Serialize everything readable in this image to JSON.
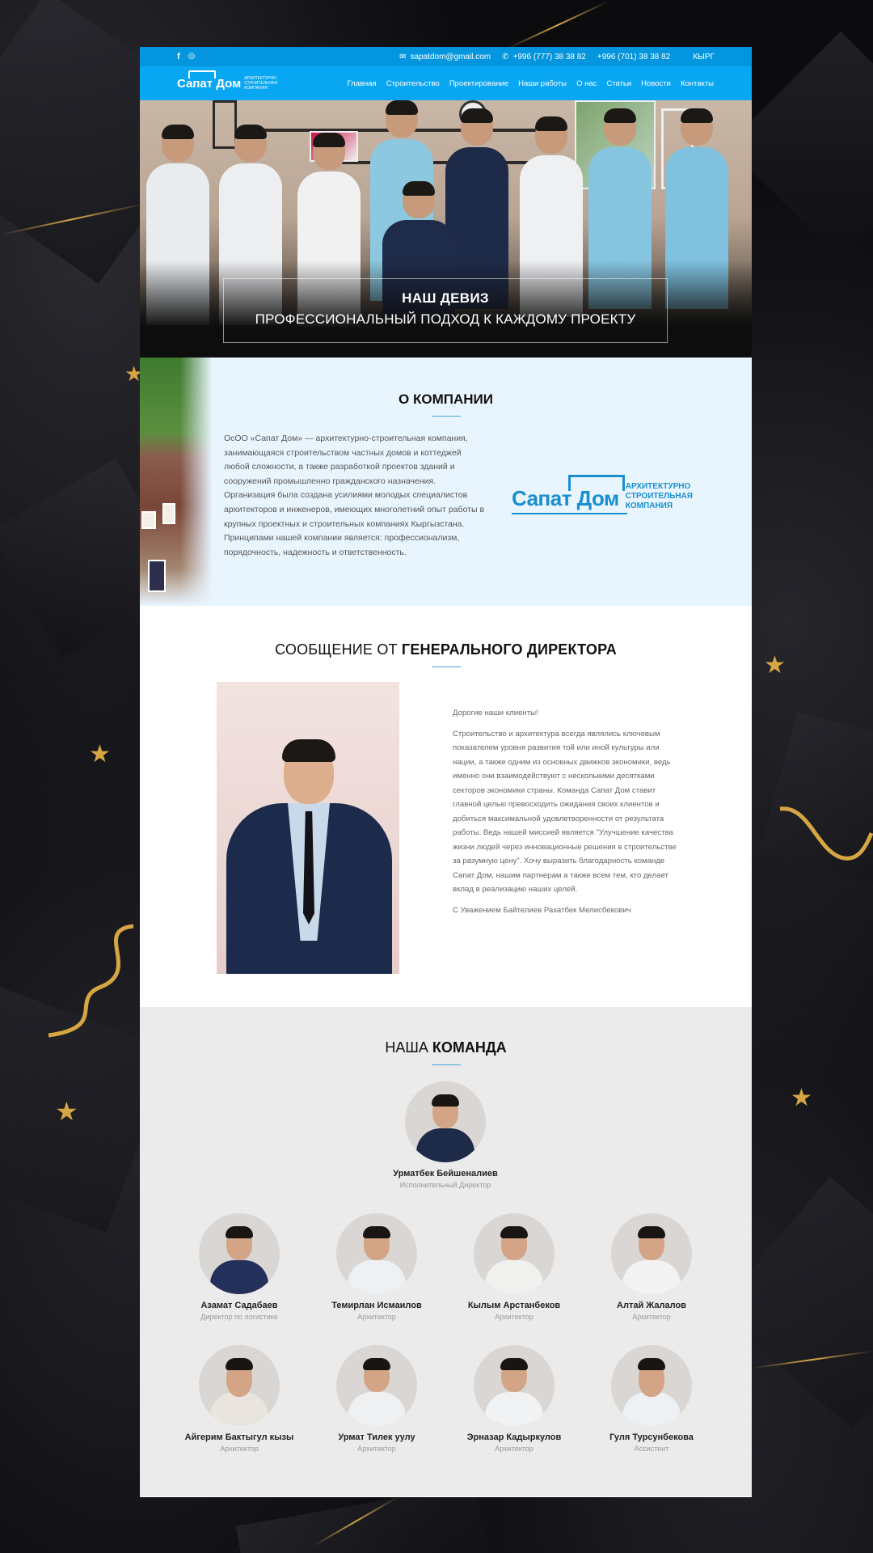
{
  "topbar": {
    "email": "sapatdom@gmail.com",
    "phone1": "+996 (777) 38 38 82",
    "phone2": "+996 (701) 38 38 82",
    "lang": "КЫРГ"
  },
  "logo": {
    "name": "Сапат Дом",
    "subtitle": "АРХИТЕКТУРНО СТРОИТЕЛЬНАЯ КОМПАНИЯ"
  },
  "nav": [
    "Главная",
    "Строительство",
    "Проектирование",
    "Наши работы",
    "О нас",
    "Статьи",
    "Новости",
    "Контакты"
  ],
  "hero": {
    "title": "НАШ ДЕВИЗ",
    "subtitle": "ПРОФЕССИОНАЛЬНЫЙ ПОДХОД К КАЖДОМУ ПРОЕКТУ"
  },
  "about": {
    "title": "О КОМПАНИИ",
    "text": "ОсОО «Сапат Дом» — архитектурно-строительная компания, занимающаяся строительством частных домов и коттеджей любой сложности, а также разработкой проектов зданий и сооружений промышленно гражданского назначения. Организация была создана усилиями молодых специалистов архитекторов и инженеров, имеющих многолетний опыт работы в крупных проектных и строительных компаниях Кыргызстана. Принципами нашей компании является: профессионализм, порядочность, надежность и ответственность.",
    "logo_main": "Сапат Дом",
    "logo_sub1": "АРХИТЕКТУРНО",
    "logo_sub2": "СТРОИТЕЛЬНАЯ",
    "logo_sub3": "КОМПАНИЯ"
  },
  "director": {
    "title_light": "СООБЩЕНИЕ ОТ ",
    "title_bold": "ГЕНЕРАЛЬНОГО ДИРЕКТОРА",
    "greeting": "Дорогие наши клиенты!",
    "text": "Строительство и архитектура всегда являлись ключевым показателем уровня развития той или иной культуры или нации, а также одним из основных движков экономики, ведь именно они взаимодействуют с несколькими десятками секторов экономики страны. Команда Сапат Дом ставит главной целью превосходить ожидания своих клиентов и добиться максимальной удовлетворенности от результата работы. Ведь нашей миссией является \"Улучшение качества жизни людей через инновационные решения в строительстве за разумную цену\". Хочу выразить благодарность команде Сапат Дом, нашим партнерам а также всем тем, кто делает вклад в реализацию наших целей.",
    "signature": "С Уважением Байтелиев Рахатбек Мелисбекович"
  },
  "team": {
    "title_light": "НАША ",
    "title_bold": "КОМАНДА",
    "lead": {
      "name": "Урматбек Бейшеналиев",
      "role": "Исполнительный Директор"
    },
    "members": [
      {
        "name": "Азамат Садабаев",
        "role": "Директор по логистике"
      },
      {
        "name": "Темирлан Исмаилов",
        "role": "Архитектор"
      },
      {
        "name": "Кылым Арстанбеков",
        "role": "Архитектор"
      },
      {
        "name": "Алтай Жалалов",
        "role": "Архитектор"
      },
      {
        "name": "Айгерим Бактыгул кызы",
        "role": "Архитектор"
      },
      {
        "name": "Урмат Тилек уулу",
        "role": "Архитектор"
      },
      {
        "name": "Эрназар Кадыркулов",
        "role": "Архитектор"
      },
      {
        "name": "Гуля Турсунбекова",
        "role": "Ассистент"
      }
    ]
  },
  "colors": {
    "topbar": "#0396de",
    "navbar": "#09a6f1",
    "brand_blue": "#1a8fcf",
    "about_bg": "#e9f5fe",
    "team_bg": "#ececec",
    "gold_accent": "#d6a544"
  }
}
